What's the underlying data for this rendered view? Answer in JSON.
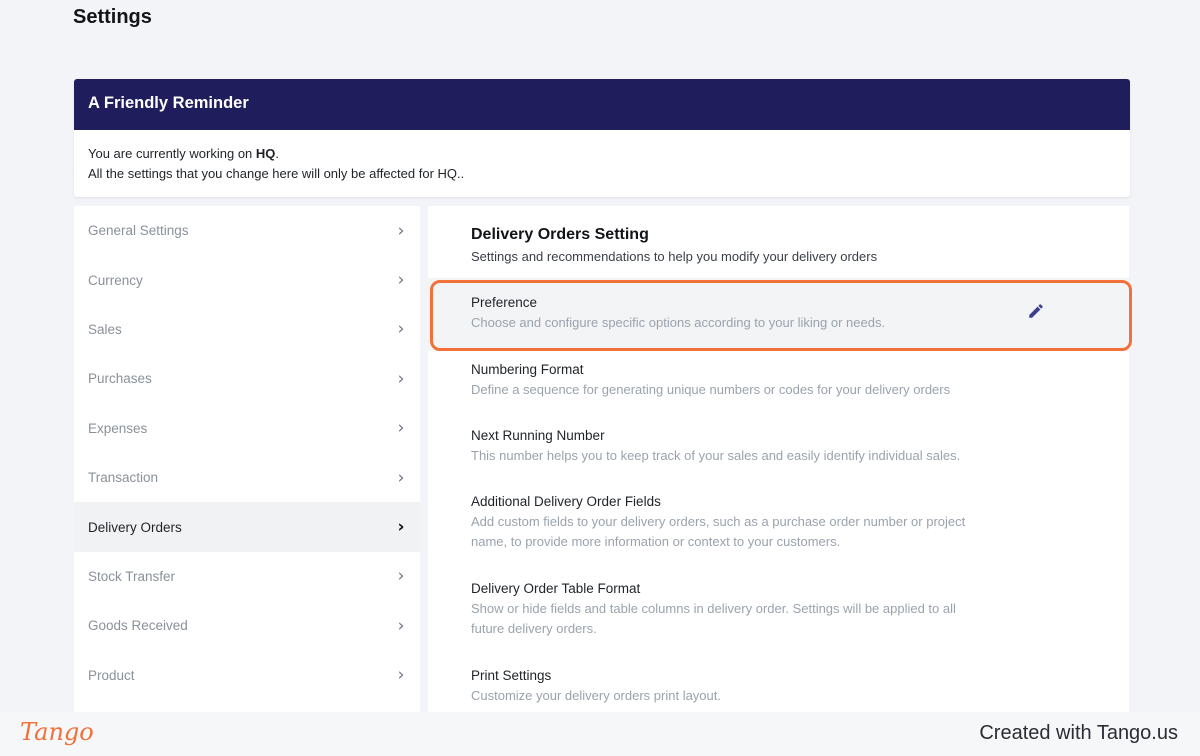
{
  "page": {
    "title": "Settings"
  },
  "reminder": {
    "title": "A Friendly Reminder",
    "line1_prefix": "You are currently working on ",
    "line1_bold": "HQ",
    "line1_suffix": ".",
    "line2": "All the settings that you change here will only be affected for HQ.."
  },
  "sidebar": {
    "items": [
      {
        "label": "General Settings"
      },
      {
        "label": "Currency"
      },
      {
        "label": "Sales"
      },
      {
        "label": "Purchases"
      },
      {
        "label": "Expenses"
      },
      {
        "label": "Transaction"
      },
      {
        "label": "Delivery Orders",
        "active": true
      },
      {
        "label": "Stock Transfer"
      },
      {
        "label": "Goods Received"
      },
      {
        "label": "Product"
      }
    ],
    "chevron": "›"
  },
  "main": {
    "title": "Delivery Orders Setting",
    "subtitle": "Settings and recommendations to help you modify your delivery orders",
    "settings": [
      {
        "name": "Preference",
        "desc": "Choose and configure specific options according to your liking or needs."
      },
      {
        "name": "Numbering Format",
        "desc": "Define a sequence for generating unique numbers or codes for your delivery orders"
      },
      {
        "name": "Next Running Number",
        "desc": "This number helps you to keep track of your sales and easily identify individual sales."
      },
      {
        "name": "Additional Delivery Order Fields",
        "desc": "Add custom fields to your delivery orders, such as a purchase order number or project name, to provide more information or context to your customers."
      },
      {
        "name": "Delivery Order Table Format",
        "desc": "Show or hide fields and table columns in delivery order. Settings will be applied to all future delivery orders."
      },
      {
        "name": "Print Settings",
        "desc": "Customize your delivery orders print layout."
      }
    ]
  },
  "footer": {
    "logo": "Tango",
    "credit": "Created with Tango.us"
  },
  "colors": {
    "header_bg": "#1f1d5b",
    "highlight": "#f2713a",
    "pencil": "#3a3f8f"
  },
  "icons": {
    "edit": "pencil-icon",
    "chevron": "chevron-right-icon"
  }
}
